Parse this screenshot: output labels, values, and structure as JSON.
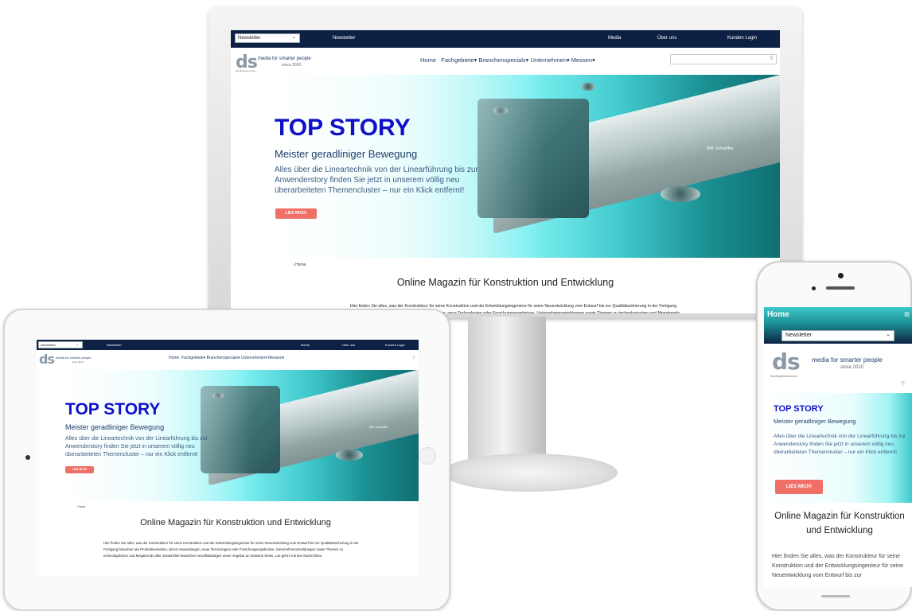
{
  "topbar": {
    "newsletter_select": "Newsletter",
    "newsletter_link": "Newsletter",
    "media_link": "Media",
    "about_link": "Über uns",
    "login_link": "Kunden Login"
  },
  "logo": {
    "wordmark": "ds",
    "subtitle": "development scout",
    "tagline": "media for smarter people",
    "since": "since 2010"
  },
  "nav": {
    "home": "Home",
    "fachgebiete": "Fachgebiete",
    "branchenspecials": "Branchenspecials",
    "unternehmen": "Unternehmen",
    "messen": "Messen",
    "chevron": "▾"
  },
  "hero": {
    "title": "TOP STORY",
    "subtitle": "Meister geradliniger Bewegung",
    "body": "Alles über die Lineartechnik von der Linearführung bis zur Anwenderstory finden Sie jetzt in unserem völlig neu überarbeiteten Themencluster – nur ein Klick entfernt!",
    "button": "LIES MICH!",
    "credit": "Bild: Schaeffler"
  },
  "breadcrumb": {
    "home": "Home"
  },
  "main": {
    "title": "Online Magazin für Konstruktion und Entwicklung",
    "body": "Hier finden Sie alles, was der Konstrukteur für seine Konstruktion und der Entwicklungsingenieur für seine Neuentwicklung vom Entwurf bis zur Qualitätssicherung in der Fertigung brauchen wie Produktneuheiten, deren Anwendungen, neue Technologien oder Forschungsergebnisse, Unternehmensmeldungen sowie Themen zu technologischen und Megatrends aller industriellen Branchen vervollständigen unser Angebot an Industrie News. Los geht's mit den Nachrichten."
  },
  "mobile": {
    "home_bar": "Home",
    "menu_icon": "≡",
    "mobile_body": "Hier finden Sie alles, was der Konstrukteur für seine Konstruktion und der Entwicklungsingenieur für seine Neuentwicklung vom Entwurf bis zur"
  },
  "colors": {
    "navy": "#0d2144",
    "accent_title": "#1010c8",
    "button": "#f07068",
    "teal": "#1b8f92"
  }
}
